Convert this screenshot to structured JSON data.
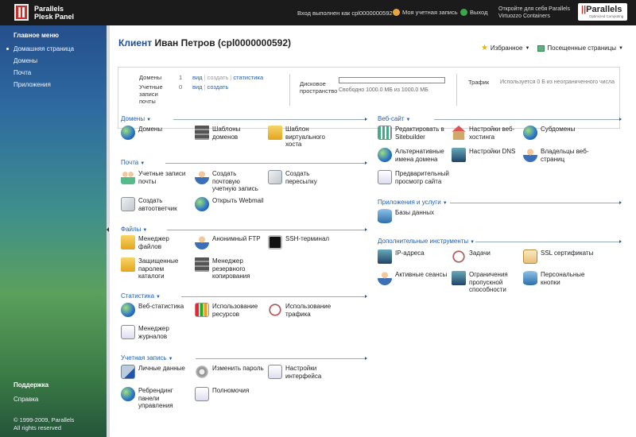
{
  "topbar": {
    "logo_line1": "Parallels",
    "logo_line2": "Plesk Panel",
    "login_text": "Вход выполнен как cpl0000000592",
    "account_label": "Моя учетная запись",
    "logout_label": "Выход",
    "promo_line1": "Откройте для себя Parallels",
    "promo_line2": "Virtuozzo Containers",
    "brand_name_prefix": "||",
    "brand_name": "Parallels",
    "brand_tagline": "Optimized Computing"
  },
  "sidebar": {
    "menu_title": "Главное меню",
    "items": [
      {
        "label": "Домашняя страница"
      },
      {
        "label": "Домены"
      },
      {
        "label": "Почта"
      },
      {
        "label": "Приложения"
      }
    ],
    "support_title": "Поддержка",
    "help_label": "Справка",
    "copyright_line1": "© 1999-2009, Parallels",
    "copyright_line2": "All rights reserved"
  },
  "page": {
    "title_label": "Клиент",
    "title_name": "Иван Петров (cpl0000000592)",
    "favorites_label": "Избранное",
    "visited_label": "Посещенные страницы"
  },
  "summary": {
    "domains_label": "Домены",
    "domains_count": "1",
    "domains_links": {
      "view": "вид",
      "create": "создать",
      "stats": "статистика"
    },
    "mail_label": "Учетные записи почты",
    "mail_count": "0",
    "mail_links": {
      "view": "вид",
      "create": "создать"
    },
    "disk_label": "Дисковое пространство",
    "disk_usage_fraction": 0,
    "disk_text": "Свободно 1000.0 МБ из 1000.0 МБ",
    "traffic_label": "Трафик",
    "traffic_text": "Используется 0 Б из неограниченного числа"
  },
  "sections": {
    "domains": {
      "title": "Домены",
      "items": [
        "Домены",
        "Шаблоны доменов",
        "Шаблон виртуального хоста"
      ]
    },
    "mail": {
      "title": "Почта",
      "items": [
        "Учетные записи почты",
        "Создать почтовую учетную запись",
        "Создать пересылку",
        "Создать автоответчик",
        "Открыть Webmail"
      ]
    },
    "files": {
      "title": "Файлы",
      "items": [
        "Менеджер файлов",
        "Анонимный FTP",
        "SSH-терминал",
        "Защищенные паролем каталоги",
        "Менеджер резервного копирования"
      ]
    },
    "stats": {
      "title": "Статистика",
      "items": [
        "Веб-статистика",
        "Использование ресурсов",
        "Использование трафика",
        "Менеджер журналов"
      ]
    },
    "account": {
      "title": "Учетная запись",
      "items": [
        "Личные данные",
        "Изменить пароль",
        "Настройки интерфейса",
        "Ребрендинг панели управления",
        "Полномочия"
      ]
    },
    "website": {
      "title": "Веб-сайт",
      "items": [
        "Редактировать в Sitebuilder",
        "Настройки веб-хостинга",
        "Субдомены",
        "Альтернативные имена домена",
        "Настройки DNS",
        "Владельцы веб-страниц",
        "Предварительный просмотр сайта"
      ]
    },
    "apps": {
      "title": "Приложения и услуги",
      "items": [
        "Базы данных"
      ]
    },
    "tools": {
      "title": "Дополнительные инструменты",
      "items": [
        "IP-адреса",
        "Задачи",
        "SSL сертификаты",
        "Активные сеансы",
        "Ограничения пропускной способности",
        "Персональные кнопки"
      ]
    }
  },
  "colors": {
    "link": "#1f5fb4",
    "topbar": "#1b1b1b",
    "accent_red": "#c9302c"
  }
}
